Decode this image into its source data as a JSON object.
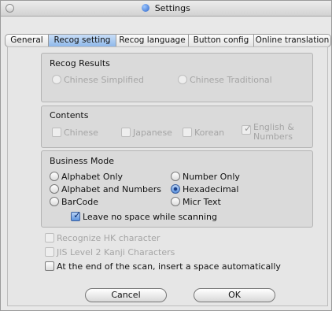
{
  "window": {
    "title": "Settings"
  },
  "tabs": [
    "General",
    "Recog setting",
    "Recog language",
    "Button config",
    "Online translation"
  ],
  "recog_results": {
    "title": "Recog Results",
    "options": [
      "Chinese Simplified",
      "Chinese Traditional"
    ]
  },
  "contents": {
    "title": "Contents",
    "options": [
      "Chinese",
      "Japanese",
      "Korean"
    ],
    "english_numbers": [
      "English &",
      "Numbers"
    ]
  },
  "business_mode": {
    "title": "Business Mode",
    "options": [
      "Alphabet Only",
      "Number Only",
      "Alphabet and Numbers",
      "Hexadecimal",
      "BarCode",
      "Micr Text"
    ],
    "selected": "Hexadecimal",
    "leave_no_space": "Leave no space while scanning"
  },
  "extra_options": [
    "Recognize HK character",
    "JIS Level 2 Kanji Characters",
    "At the end of the scan, insert a space automatically"
  ],
  "buttons": {
    "cancel": "Cancel",
    "ok": "OK"
  }
}
